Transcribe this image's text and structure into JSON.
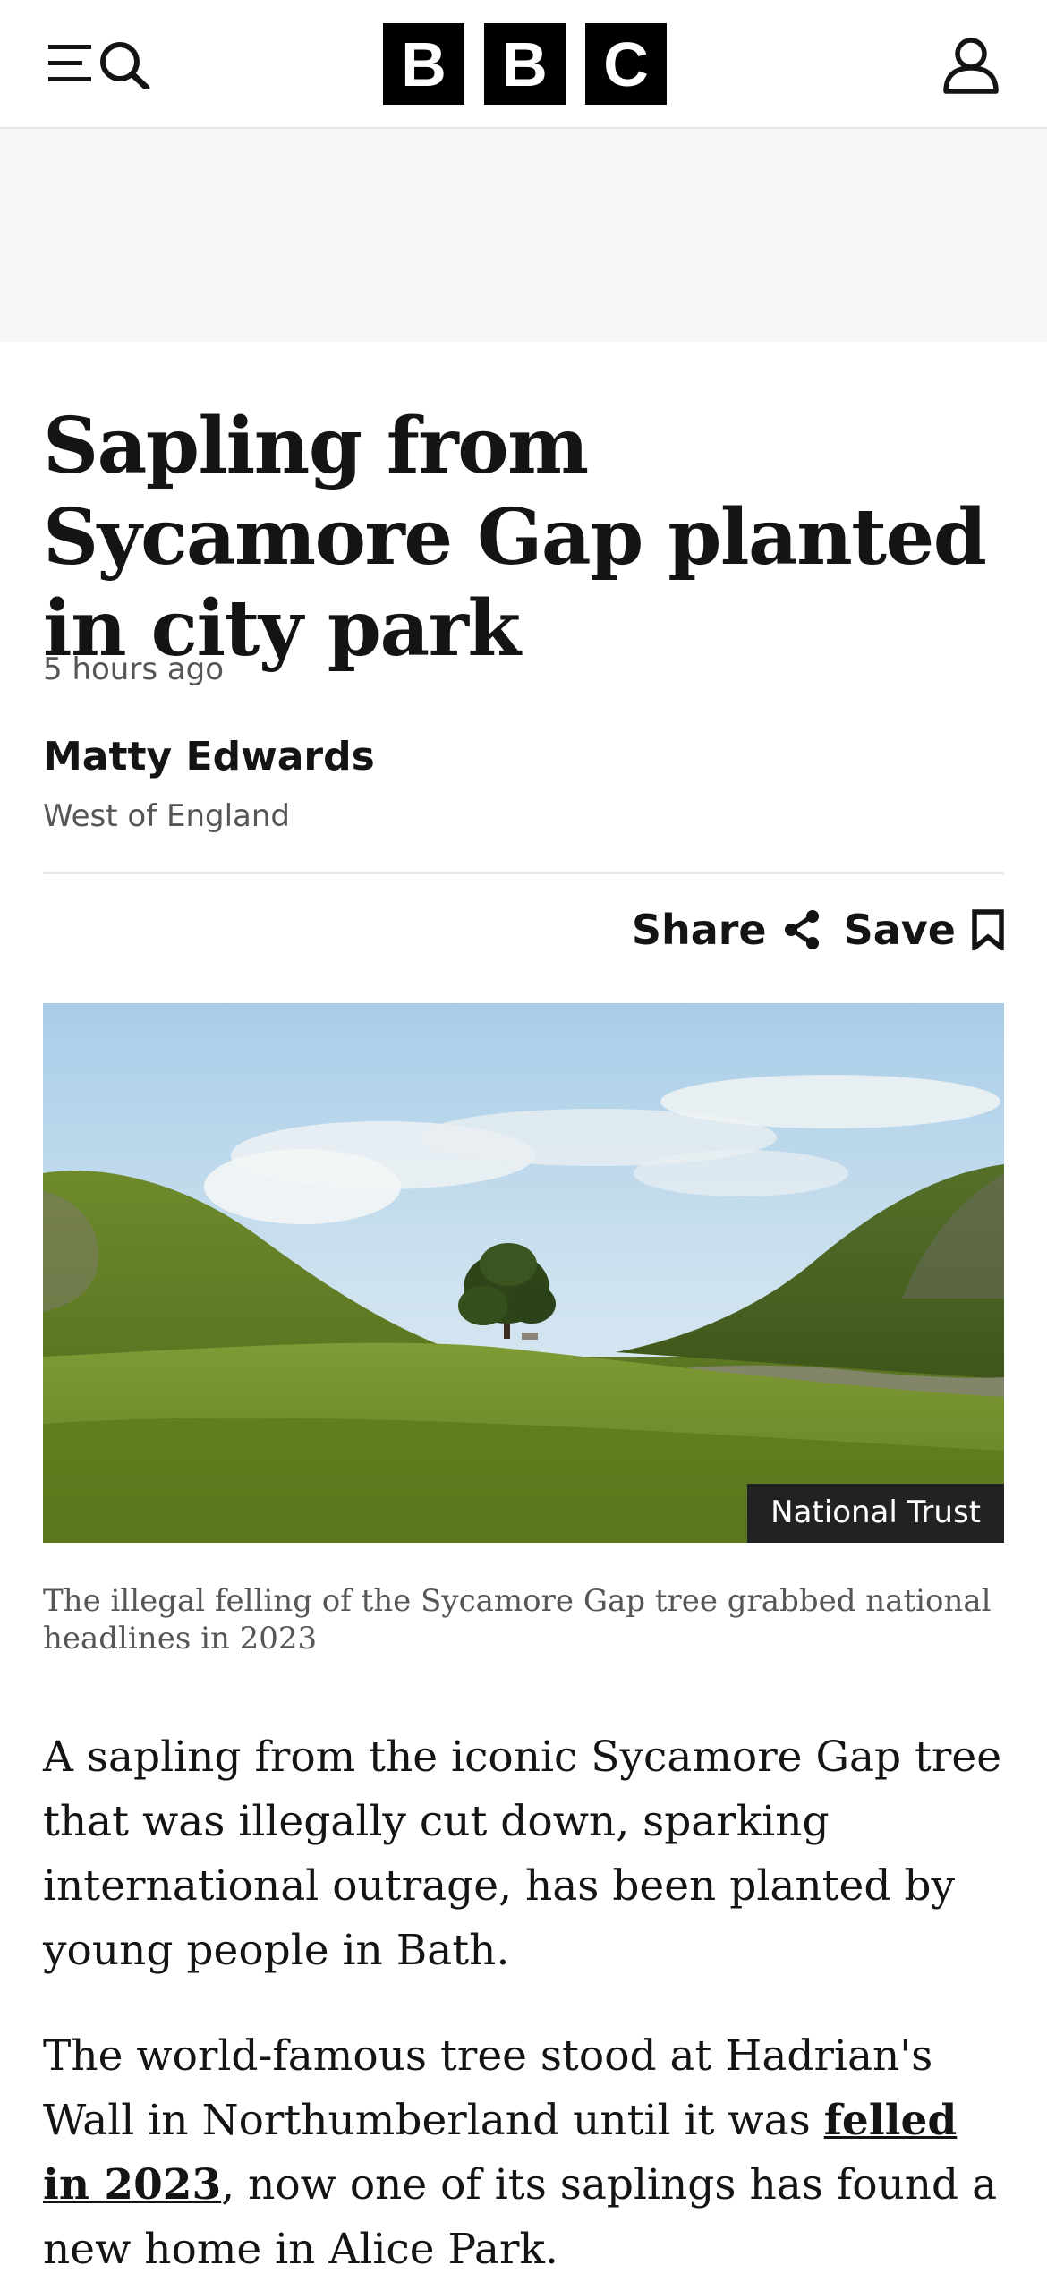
{
  "header": {
    "logo_letters": [
      "B",
      "B",
      "C"
    ],
    "icons": {
      "menu": "menu-icon",
      "search": "search-icon",
      "account": "account-icon"
    }
  },
  "article": {
    "headline": "Sapling from Sycamore Gap planted in city park",
    "timestamp": "5 hours ago",
    "author": {
      "name": "Matty Edwards",
      "department": "West of England"
    },
    "actions": {
      "share_label": "Share",
      "save_label": "Save"
    },
    "image": {
      "credit": "National Trust",
      "caption": "The illegal felling of the Sycamore Gap tree grabbed national headlines in 2023"
    },
    "paragraph1": "A sapling from the iconic Sycamore Gap tree that was illegally cut down, sparking international outrage, has been planted by young people in Bath.",
    "paragraph2": {
      "before_link": "The world-famous tree stood at Hadrian's Wall in Northumberland until it was ",
      "link": "felled in 2023",
      "after_link": ", now one of its saplings has found a new home in Alice Park."
    }
  },
  "colors": {
    "text": "#141414",
    "secondary_text": "#545658",
    "logo_block": "#000000",
    "ad_background": "#f6f6f6",
    "credit_background": "#202224"
  }
}
